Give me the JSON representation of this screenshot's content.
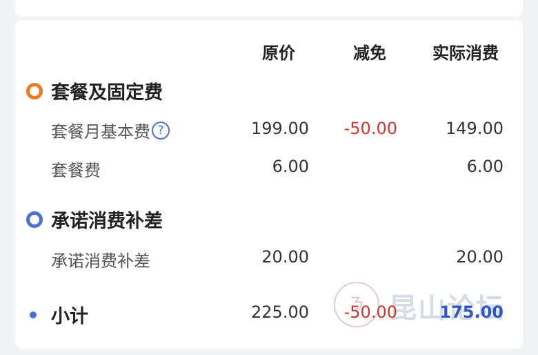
{
  "columns": {
    "original": "原价",
    "discount": "减免",
    "actual": "实际消费"
  },
  "sections": [
    {
      "title": "套餐及固定费",
      "marker_color": "#f07a1a",
      "rows": [
        {
          "label": "套餐月基本费",
          "original": "199.00",
          "discount": "-50.00",
          "actual": "149.00"
        },
        {
          "label": "套餐费",
          "original": "6.00",
          "discount": "",
          "actual": "6.00"
        }
      ]
    },
    {
      "title": "承诺消费补差",
      "marker_color": "#4a6fd8",
      "rows": [
        {
          "label": "承诺消费补差",
          "original": "20.00",
          "discount": "",
          "actual": "20.00"
        }
      ]
    }
  ],
  "subtotal": {
    "label": "小计",
    "original": "225.00",
    "discount": "-50.00",
    "actual": "175.00",
    "marker_color": "#4a6fd8"
  },
  "help_icon": "question-icon",
  "watermark": {
    "text": "昆山论坛",
    "seal_glyph": "ㄋ"
  },
  "colors": {
    "negative": "#d0342c",
    "total": "#2f55c8"
  }
}
